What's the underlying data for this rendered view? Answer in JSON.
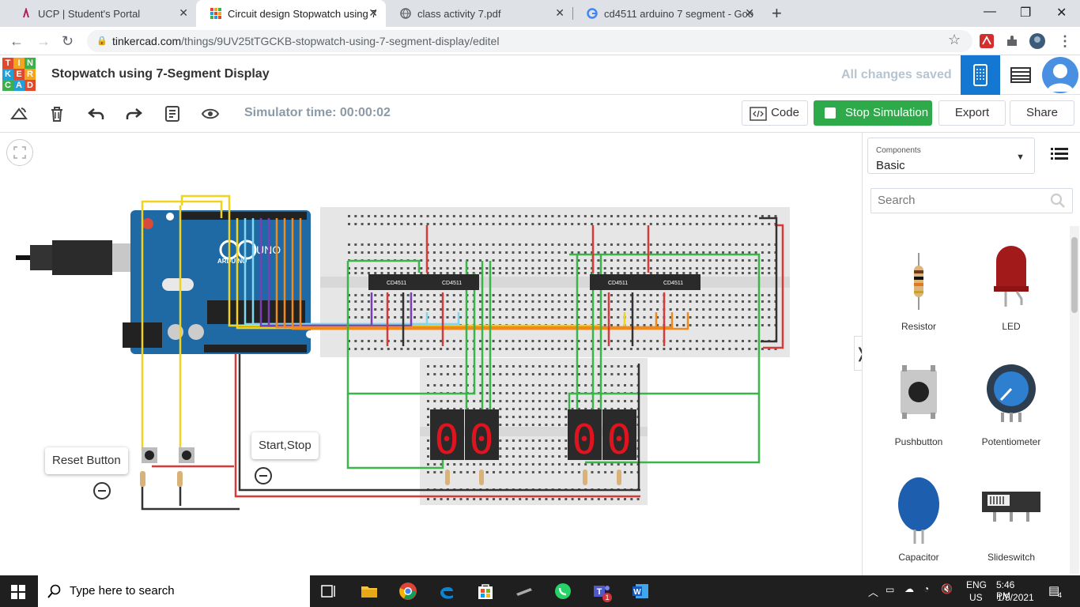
{
  "browser": {
    "tabs": [
      {
        "title": "UCP | Student's Portal",
        "active": false
      },
      {
        "title": "Circuit design Stopwatch using 7",
        "active": true
      },
      {
        "title": "class activity 7.pdf",
        "active": false
      },
      {
        "title": "cd4511 arduino 7 segment - Goo",
        "active": false
      }
    ],
    "url_host": "tinkercad.com",
    "url_path": "/things/9UV25tTGCKB-stopwatch-using-7-segment-display/editel"
  },
  "app": {
    "logo_letters": [
      "T",
      "I",
      "N",
      "K",
      "E",
      "R",
      "C",
      "A",
      "D"
    ],
    "design_title": "Stopwatch using 7-Segment Display",
    "save_status": "All changes saved"
  },
  "toolbar": {
    "sim_time": "Simulator time: 00:00:02",
    "code_label": "Code",
    "stop_label": "Stop Simulation",
    "export_label": "Export",
    "share_label": "Share"
  },
  "canvas": {
    "callouts": [
      {
        "text": "Reset Button"
      },
      {
        "text": "Start,Stop"
      }
    ],
    "ic_label": "CD4511",
    "arduino_label": "UNO",
    "arduino_brand": "ARDUINO",
    "digits": [
      "0",
      "0",
      "0",
      "0"
    ]
  },
  "panel": {
    "components_label": "Components",
    "components_value": "Basic",
    "search_placeholder": "Search",
    "items": [
      {
        "name": "Resistor",
        "icon": "resistor-icon"
      },
      {
        "name": "LED",
        "icon": "led-icon"
      },
      {
        "name": "Pushbutton",
        "icon": "pushbutton-icon"
      },
      {
        "name": "Potentiometer",
        "icon": "potentiometer-icon"
      },
      {
        "name": "Capacitor",
        "icon": "capacitor-icon"
      },
      {
        "name": "Slideswitch",
        "icon": "slideswitch-icon"
      }
    ]
  },
  "taskbar": {
    "search_placeholder": "Type here to search",
    "lang": "ENG",
    "region": "US",
    "time": "5:46 PM",
    "date": "1/5/2021",
    "notif_count": "4",
    "teams_badge": "1"
  },
  "colors": {
    "tinkercad_blue": "#1477d1",
    "sim_green": "#2faa4a",
    "arduino_blue": "#1f6aa5",
    "breadboard": "#e6e6e6",
    "segment_red": "#e0141e"
  }
}
